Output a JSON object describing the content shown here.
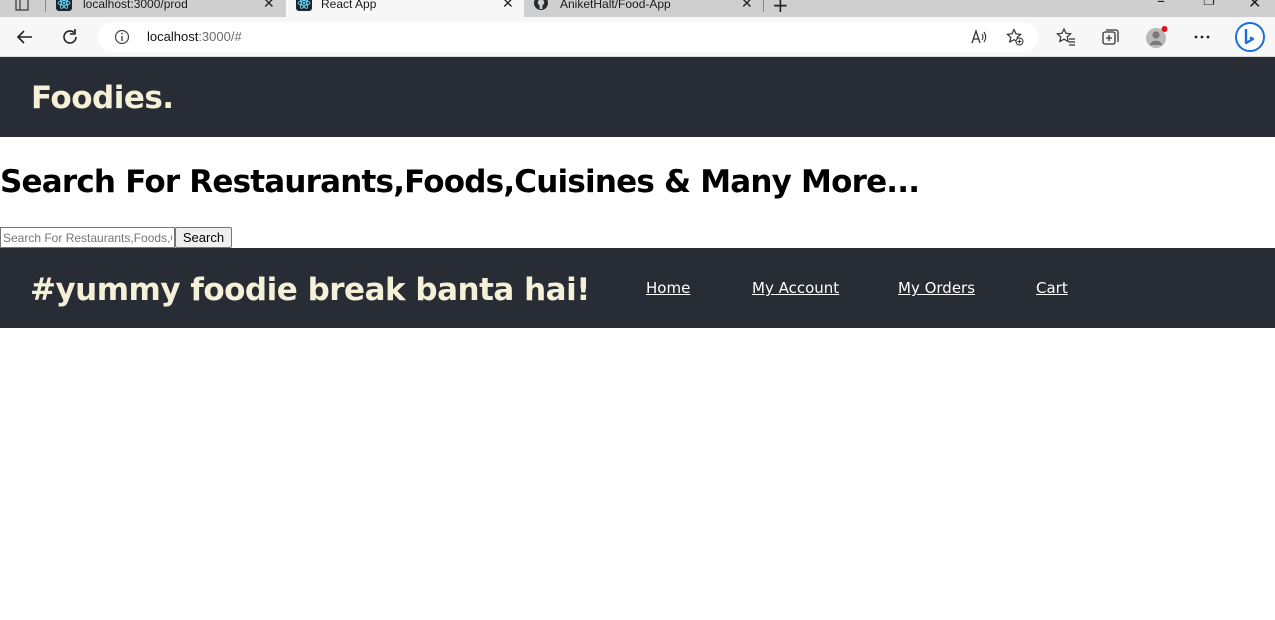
{
  "browser": {
    "tabs": [
      {
        "title": "localhost:3000/prod",
        "icon": "react-icon",
        "active": false
      },
      {
        "title": "React App",
        "icon": "react-icon",
        "active": true
      },
      {
        "title": "AniketHalt/Food-App",
        "icon": "github-icon",
        "active": false
      }
    ],
    "address": {
      "host": "localhost",
      "path": ":3000/#"
    }
  },
  "header": {
    "logo": "Foodies."
  },
  "search": {
    "heading": "Search For Restaurants,Foods,Cuisines & Many More...",
    "placeholder": "Search For Restaurants,Foods,Cuisines & Many More...",
    "button_label": "Search"
  },
  "footer_header": {
    "tagline": "#yummy foodie break banta hai!",
    "nav": [
      "Home",
      "My Account",
      "My Orders",
      "Cart"
    ]
  },
  "colors": {
    "header_bg": "#282c34",
    "logo_text": "#f5f0d8",
    "nav_text": "#ffffff"
  }
}
